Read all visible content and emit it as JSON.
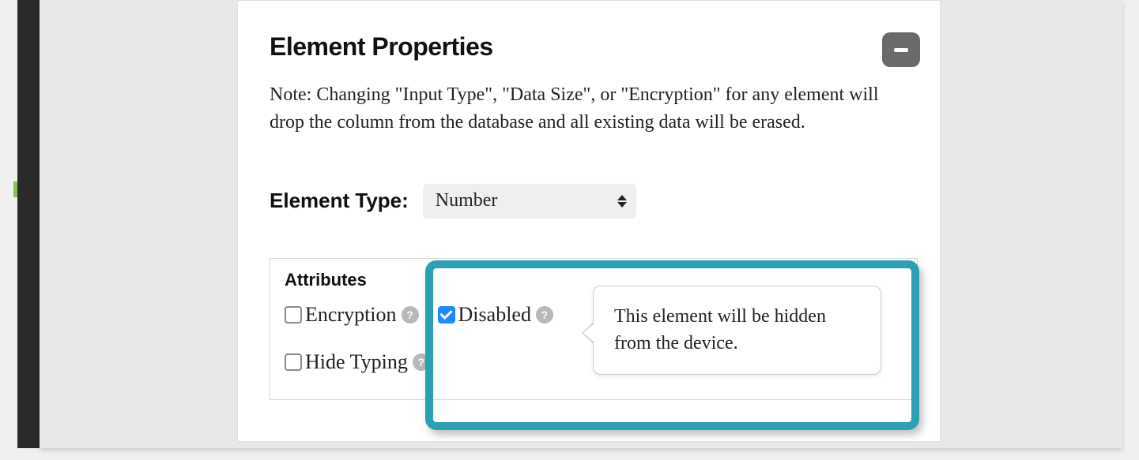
{
  "panel": {
    "title": "Element Properties",
    "note": "Note: Changing \"Input Type\", \"Data Size\", or \"Encryption\" for any element will drop the column from the database and all existing data will be erased.",
    "collapse_icon": "minus-icon"
  },
  "element_type": {
    "label": "Element Type:",
    "selected": "Number"
  },
  "attributes": {
    "title": "Attributes",
    "items": [
      {
        "label": "Encryption",
        "checked": false,
        "help": "?"
      },
      {
        "label": "Disabled",
        "checked": true,
        "help": "?"
      },
      {
        "label": "Hide Typing",
        "checked": false,
        "help": "?"
      }
    ]
  },
  "tooltip": {
    "text": "This element will be hidden from the device."
  }
}
